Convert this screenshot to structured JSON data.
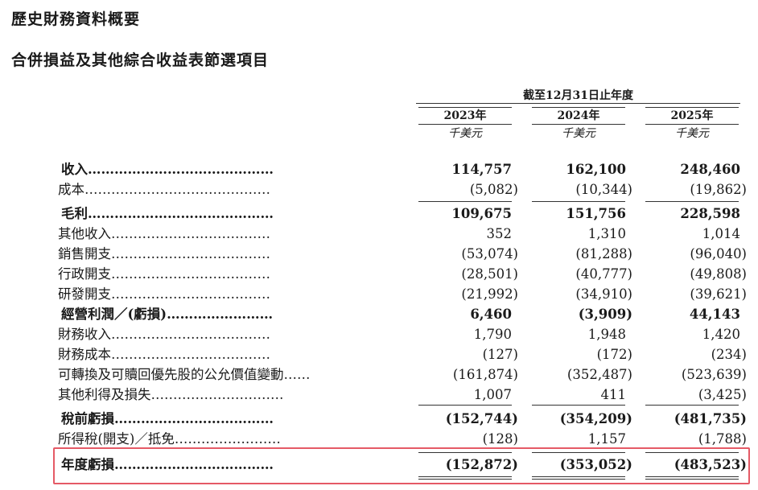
{
  "title": "歷史財務資料概要",
  "subtitle": "合併損益及其他綜合收益表節選項目",
  "period_header": "截至12月31日止年度",
  "years": [
    "2023年",
    "2024年",
    "2025年"
  ],
  "unit": "千美元",
  "rows": [
    {
      "label": "收入",
      "dots": "……………………………………",
      "v1": "114,757",
      "v2": "162,100",
      "v3": "248,460"
    },
    {
      "label": "成本",
      "dots": "……………………………………",
      "v1": "(5,082)",
      "v2": "(10,344)",
      "v3": "(19,862)"
    },
    {
      "label": "毛利",
      "dots": "……………………………………",
      "v1": "109,675",
      "v2": "151,756",
      "v3": "228,598"
    },
    {
      "label": "其他收入",
      "dots": "………………………………",
      "v1": "352",
      "v2": "1,310",
      "v3": "1,014"
    },
    {
      "label": "銷售開支",
      "dots": "………………………………",
      "v1": "(53,074)",
      "v2": "(81,288)",
      "v3": "(96,040)"
    },
    {
      "label": "行政開支",
      "dots": "………………………………",
      "v1": "(28,501)",
      "v2": "(40,777)",
      "v3": "(49,808)"
    },
    {
      "label": "研發開支",
      "dots": "………………………………",
      "v1": "(21,992)",
      "v2": "(34,910)",
      "v3": "(39,621)"
    },
    {
      "label": "經營利潤／(虧損)",
      "dots": "……………………",
      "v1": "6,460",
      "v2": "(3,909)",
      "v3": "44,143"
    },
    {
      "label": "財務收入",
      "dots": "………………………………",
      "v1": "1,790",
      "v2": "1,948",
      "v3": "1,420"
    },
    {
      "label": "財務成本",
      "dots": "………………………………",
      "v1": "(127)",
      "v2": "(172)",
      "v3": "(234)"
    },
    {
      "label": "可轉換及可贖回優先股的公允價值變動",
      "dots": "……",
      "v1": "(161,874)",
      "v2": "(352,487)",
      "v3": "(523,639)"
    },
    {
      "label": "其他利得及損失",
      "dots": "…………………………",
      "v1": "1,007",
      "v2": "411",
      "v3": "(3,425)"
    },
    {
      "label": "稅前虧損",
      "dots": "………………………………",
      "v1": "(152,744)",
      "v2": "(354,209)",
      "v3": "(481,735)"
    },
    {
      "label": "所得稅(開支)／抵免",
      "dots": "……………………",
      "v1": "(128)",
      "v2": "1,157",
      "v3": "(1,788)"
    },
    {
      "label": "年度虧損",
      "dots": "………………………………",
      "v1": "(152,872)",
      "v2": "(353,052)",
      "v3": "(483,523)"
    }
  ]
}
